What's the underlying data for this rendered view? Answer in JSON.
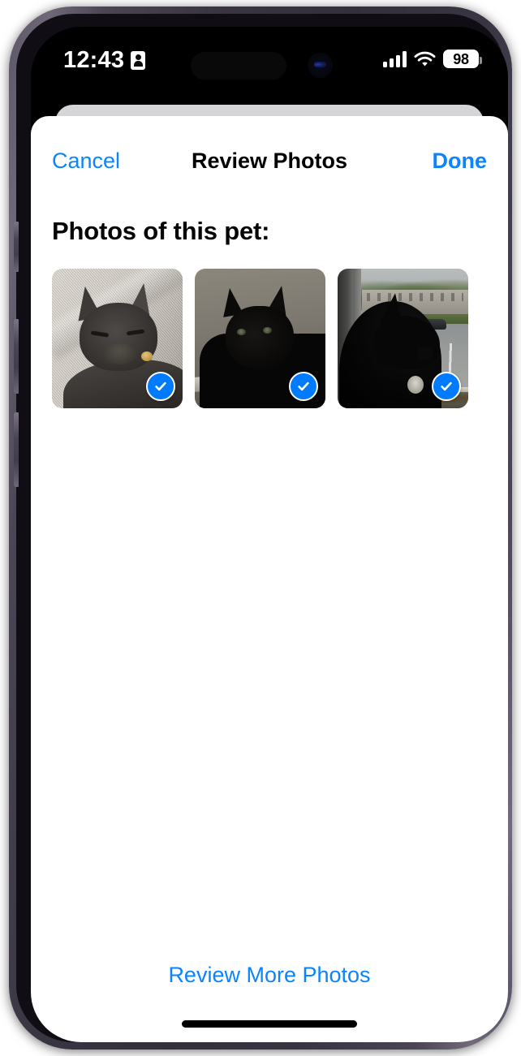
{
  "status_bar": {
    "time": "12:43",
    "focus_icon": "id-card-icon",
    "cellular_icon": "cellular-signal-icon",
    "wifi_icon": "wifi-icon",
    "battery_level": "98",
    "battery_icon": "battery-icon"
  },
  "nav_bar": {
    "cancel_label": "Cancel",
    "title": "Review Photos",
    "done_label": "Done"
  },
  "content": {
    "section_heading": "Photos of this pet:",
    "photos": [
      {
        "alt": "Dark gray cat sleeping on a light gray textured couch cushion",
        "selected": true,
        "badge_icon": "checkmark-circle-icon"
      },
      {
        "alt": "Black cat sitting in dim light against a gray wall",
        "selected": true,
        "badge_icon": "checkmark-circle-icon"
      },
      {
        "alt": "Black cat in profile looking out a window at a parking lot",
        "selected": true,
        "badge_icon": "checkmark-circle-icon"
      }
    ]
  },
  "footer": {
    "review_more_label": "Review More Photos"
  },
  "colors": {
    "accent_blue": "#0a84ff",
    "badge_blue": "#007aff",
    "sheet_white": "#ffffff",
    "sheet_behind_gray": "#d5d5d7",
    "text_black": "#000000",
    "screen_black": "#000000",
    "frame_titanium": "#4b4554"
  },
  "device": {
    "buttons": [
      "action-button",
      "volume-up-button",
      "volume-down-button",
      "power-button"
    ],
    "dynamic_island": "dynamic-island",
    "front_camera": "front-camera",
    "home_indicator": "home-indicator"
  }
}
